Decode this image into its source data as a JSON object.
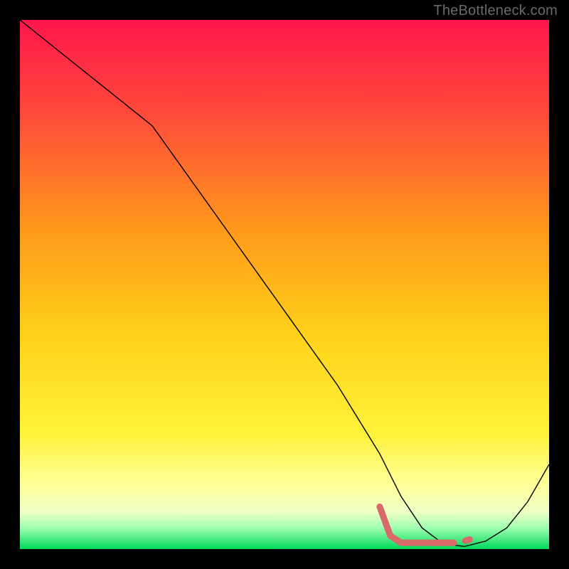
{
  "watermark": "TheBottleneck.com",
  "chart_data": {
    "type": "line",
    "title": "",
    "xlabel": "",
    "ylabel": "",
    "xlim": [
      0,
      100
    ],
    "ylim": [
      0,
      100
    ],
    "grid": false,
    "legend": false,
    "background_gradient": {
      "top": "#ff1a4a",
      "mid1": "#ff9e1a",
      "mid2": "#ffee33",
      "low": "#ffffaa",
      "bottom": "#00d85a"
    },
    "series": [
      {
        "name": "curve",
        "color": "#000000",
        "stroke_width": 1.4,
        "x": [
          0,
          10,
          20,
          25,
          30,
          40,
          50,
          60,
          68,
          72,
          76,
          80,
          84,
          88,
          92,
          96,
          100
        ],
        "y": [
          100,
          92,
          84,
          80,
          73,
          59,
          45,
          31,
          18,
          10,
          4,
          1,
          0.5,
          1.5,
          4,
          9,
          16
        ]
      },
      {
        "name": "highlight",
        "color": "#d96a6a",
        "stroke_width": 8,
        "dashed": false,
        "x": [
          68,
          70,
          72,
          73,
          82,
          83,
          84
        ],
        "y": [
          6,
          2,
          1,
          1,
          1.2,
          1.2,
          1.8
        ]
      }
    ],
    "highlight_segments": [
      {
        "x": [
          68,
          70,
          72,
          82
        ],
        "y": [
          8,
          2.5,
          1.2,
          1.2
        ],
        "solid": true
      },
      {
        "x": [
          78.5,
          81.5
        ],
        "y": [
          1.2,
          1.2
        ],
        "solid": true
      },
      {
        "x": [
          84.2,
          85.0
        ],
        "y": [
          1.6,
          1.8
        ],
        "solid": true
      }
    ]
  }
}
